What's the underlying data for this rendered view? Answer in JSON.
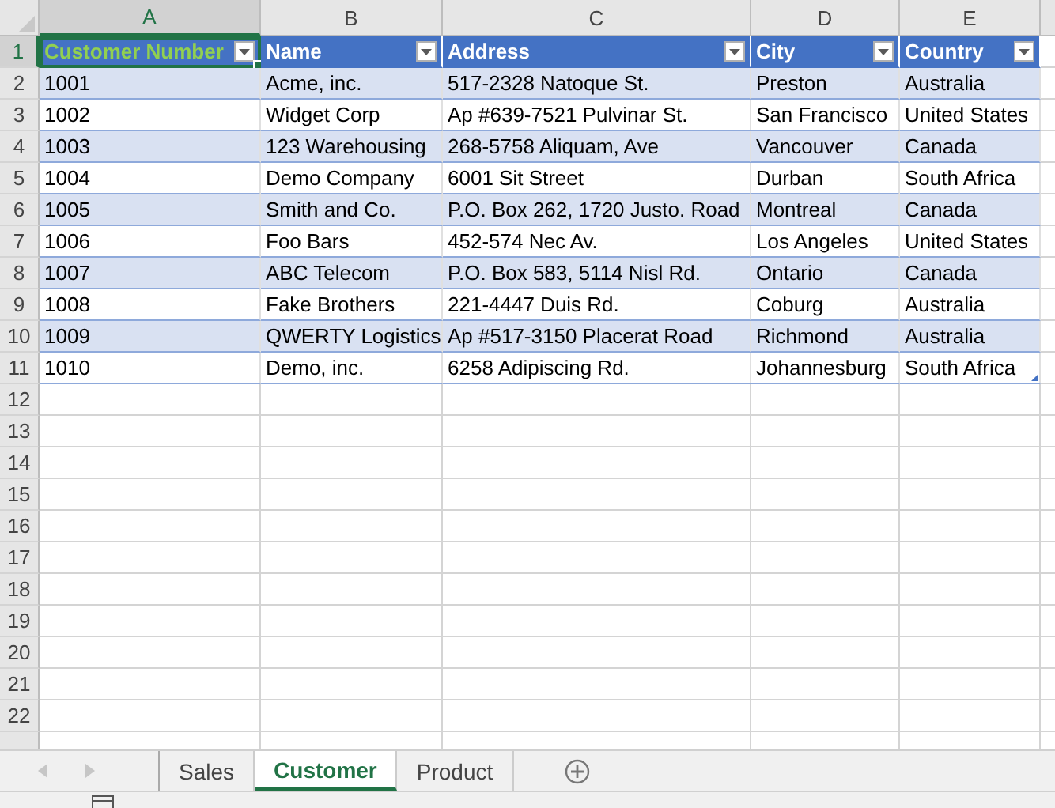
{
  "column_headers": [
    {
      "letter": "A",
      "selected": true
    },
    {
      "letter": "B",
      "selected": false
    },
    {
      "letter": "C",
      "selected": false
    },
    {
      "letter": "D",
      "selected": false
    },
    {
      "letter": "E",
      "selected": false
    }
  ],
  "row_numbers": [
    {
      "label": "1",
      "selected": true
    },
    {
      "label": "2",
      "selected": false
    },
    {
      "label": "3",
      "selected": false
    },
    {
      "label": "4",
      "selected": false
    },
    {
      "label": "5",
      "selected": false
    },
    {
      "label": "6",
      "selected": false
    },
    {
      "label": "7",
      "selected": false
    },
    {
      "label": "8",
      "selected": false
    },
    {
      "label": "9",
      "selected": false
    },
    {
      "label": "10",
      "selected": false
    },
    {
      "label": "11",
      "selected": false
    },
    {
      "label": "12",
      "selected": false
    },
    {
      "label": "13",
      "selected": false
    },
    {
      "label": "14",
      "selected": false
    },
    {
      "label": "15",
      "selected": false
    },
    {
      "label": "16",
      "selected": false
    },
    {
      "label": "17",
      "selected": false
    },
    {
      "label": "18",
      "selected": false
    },
    {
      "label": "19",
      "selected": false
    },
    {
      "label": "20",
      "selected": false
    },
    {
      "label": "21",
      "selected": false
    },
    {
      "label": "22",
      "selected": false
    }
  ],
  "table": {
    "columns": [
      {
        "label": "Customer Number",
        "selected": true
      },
      {
        "label": "Name",
        "selected": false
      },
      {
        "label": "Address",
        "selected": false
      },
      {
        "label": "City",
        "selected": false
      },
      {
        "label": "Country",
        "selected": false
      }
    ],
    "rows": [
      [
        "1001",
        "Acme, inc.",
        "517-2328 Natoque St.",
        "Preston",
        "Australia"
      ],
      [
        "1002",
        "Widget Corp",
        "Ap #639-7521 Pulvinar St.",
        "San Francisco",
        "United States"
      ],
      [
        "1003",
        "123 Warehousing",
        "268-5758 Aliquam, Ave",
        "Vancouver",
        "Canada"
      ],
      [
        "1004",
        "Demo Company",
        "6001 Sit Street",
        "Durban",
        "South Africa"
      ],
      [
        "1005",
        "Smith and Co.",
        "P.O. Box 262, 1720 Justo. Road",
        "Montreal",
        "Canada"
      ],
      [
        "1006",
        "Foo Bars",
        "452-574 Nec Av.",
        "Los Angeles",
        "United States"
      ],
      [
        "1007",
        "ABC Telecom",
        "P.O. Box 583, 5114 Nisl Rd.",
        "Ontario",
        "Canada"
      ],
      [
        "1008",
        "Fake Brothers",
        "221-4447 Duis Rd.",
        "Coburg",
        "Australia"
      ],
      [
        "1009",
        "QWERTY Logistics",
        "Ap #517-3150 Placerat Road",
        "Richmond",
        "Australia"
      ],
      [
        "1010",
        "Demo, inc.",
        "6258 Adipiscing Rd.",
        "Johannesburg",
        "South Africa"
      ]
    ]
  },
  "sheet_tabs": [
    {
      "label": "Sales",
      "selected": false
    },
    {
      "label": "Customer",
      "selected": true
    },
    {
      "label": "Product",
      "selected": false
    }
  ]
}
